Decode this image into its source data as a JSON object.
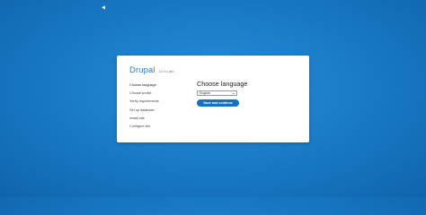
{
  "installer": {
    "brand": "Drupal",
    "version": "10.0.0-dev",
    "steps": [
      {
        "label": "Choose language",
        "active": true
      },
      {
        "label": "Choose profile",
        "active": false
      },
      {
        "label": "Verify requirements",
        "active": false
      },
      {
        "label": "Set up database",
        "active": false
      },
      {
        "label": "Install site",
        "active": false
      },
      {
        "label": "Configure site",
        "active": false
      }
    ],
    "title": "Choose language",
    "language_select": {
      "value": "English"
    },
    "submit_label": "Save and continue"
  }
}
